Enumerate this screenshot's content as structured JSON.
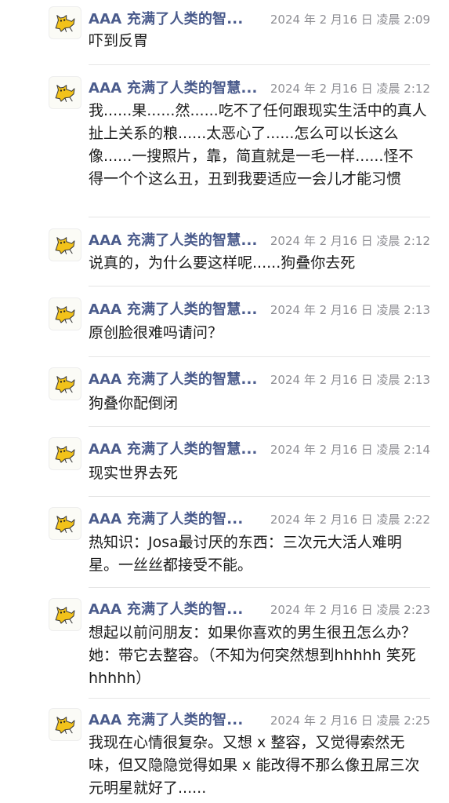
{
  "messages": [
    {
      "author": "AAA 充满了人类的智...",
      "time": "2024 年 2 月16 日 凌晨 2:09",
      "text": "吓到反胃"
    },
    {
      "author": "AAA 充满了人类的智慧...",
      "time": "2024 年 2 月16 日 凌晨 2:12",
      "text": "我......果......然......吃不了任何跟现实生活中的真人扯上关系的粮......太恶心了......怎么可以长这么像......一搜照片，靠，简直就是一毛一样......怪不得一个个这么丑，丑到我要适应一会儿才能习惯"
    },
    {
      "author": "AAA 充满了人类的智慧...",
      "time": "2024 年 2 月16 日 凌晨 2:12",
      "text": "说真的，为什么要这样呢......狗叠你去死"
    },
    {
      "author": "AAA 充满了人类的智慧...",
      "time": "2024 年 2 月16 日 凌晨 2:13",
      "text": "原创脸很难吗请问？"
    },
    {
      "author": "AAA 充满了人类的智慧...",
      "time": "2024 年 2 月16 日 凌晨 2:13",
      "text": "狗叠你配倒闭"
    },
    {
      "author": "AAA 充满了人类的智慧...",
      "time": "2024 年 2 月16 日 凌晨 2:14",
      "text": "现实世界去死"
    },
    {
      "author": "AAA 充满了人类的智...",
      "time": "2024 年 2 月16 日 凌晨 2:22",
      "text": "热知识：Josa最讨厌的东西：三次元大活人难明星。一丝丝都接受不能。"
    },
    {
      "author": "AAA 充满了人类的智...",
      "time": "2024 年 2 月16 日 凌晨 2:23",
      "text": "想起以前问朋友：如果你喜欢的男生很丑怎么办？她：带它去整容。（不知为何突然想到hhhhh 笑死 hhhhh）"
    },
    {
      "author": "AAA 充满了人类的智...",
      "time": "2024 年 2 月16 日 凌晨 2:25",
      "text": "我现在心情很复杂。又想 x 整容，又觉得索然无味，但又隐隐觉得如果 x 能改得不那么像丑屌三次元明星就好了......"
    }
  ],
  "colors": {
    "author": "#4a5b8c",
    "time": "#8e8e93",
    "text": "#1b1b1b",
    "divider": "#e5e5e5",
    "avatar_cat": "#f2c21a"
  },
  "avatar_icon": "yellow-cat-icon"
}
